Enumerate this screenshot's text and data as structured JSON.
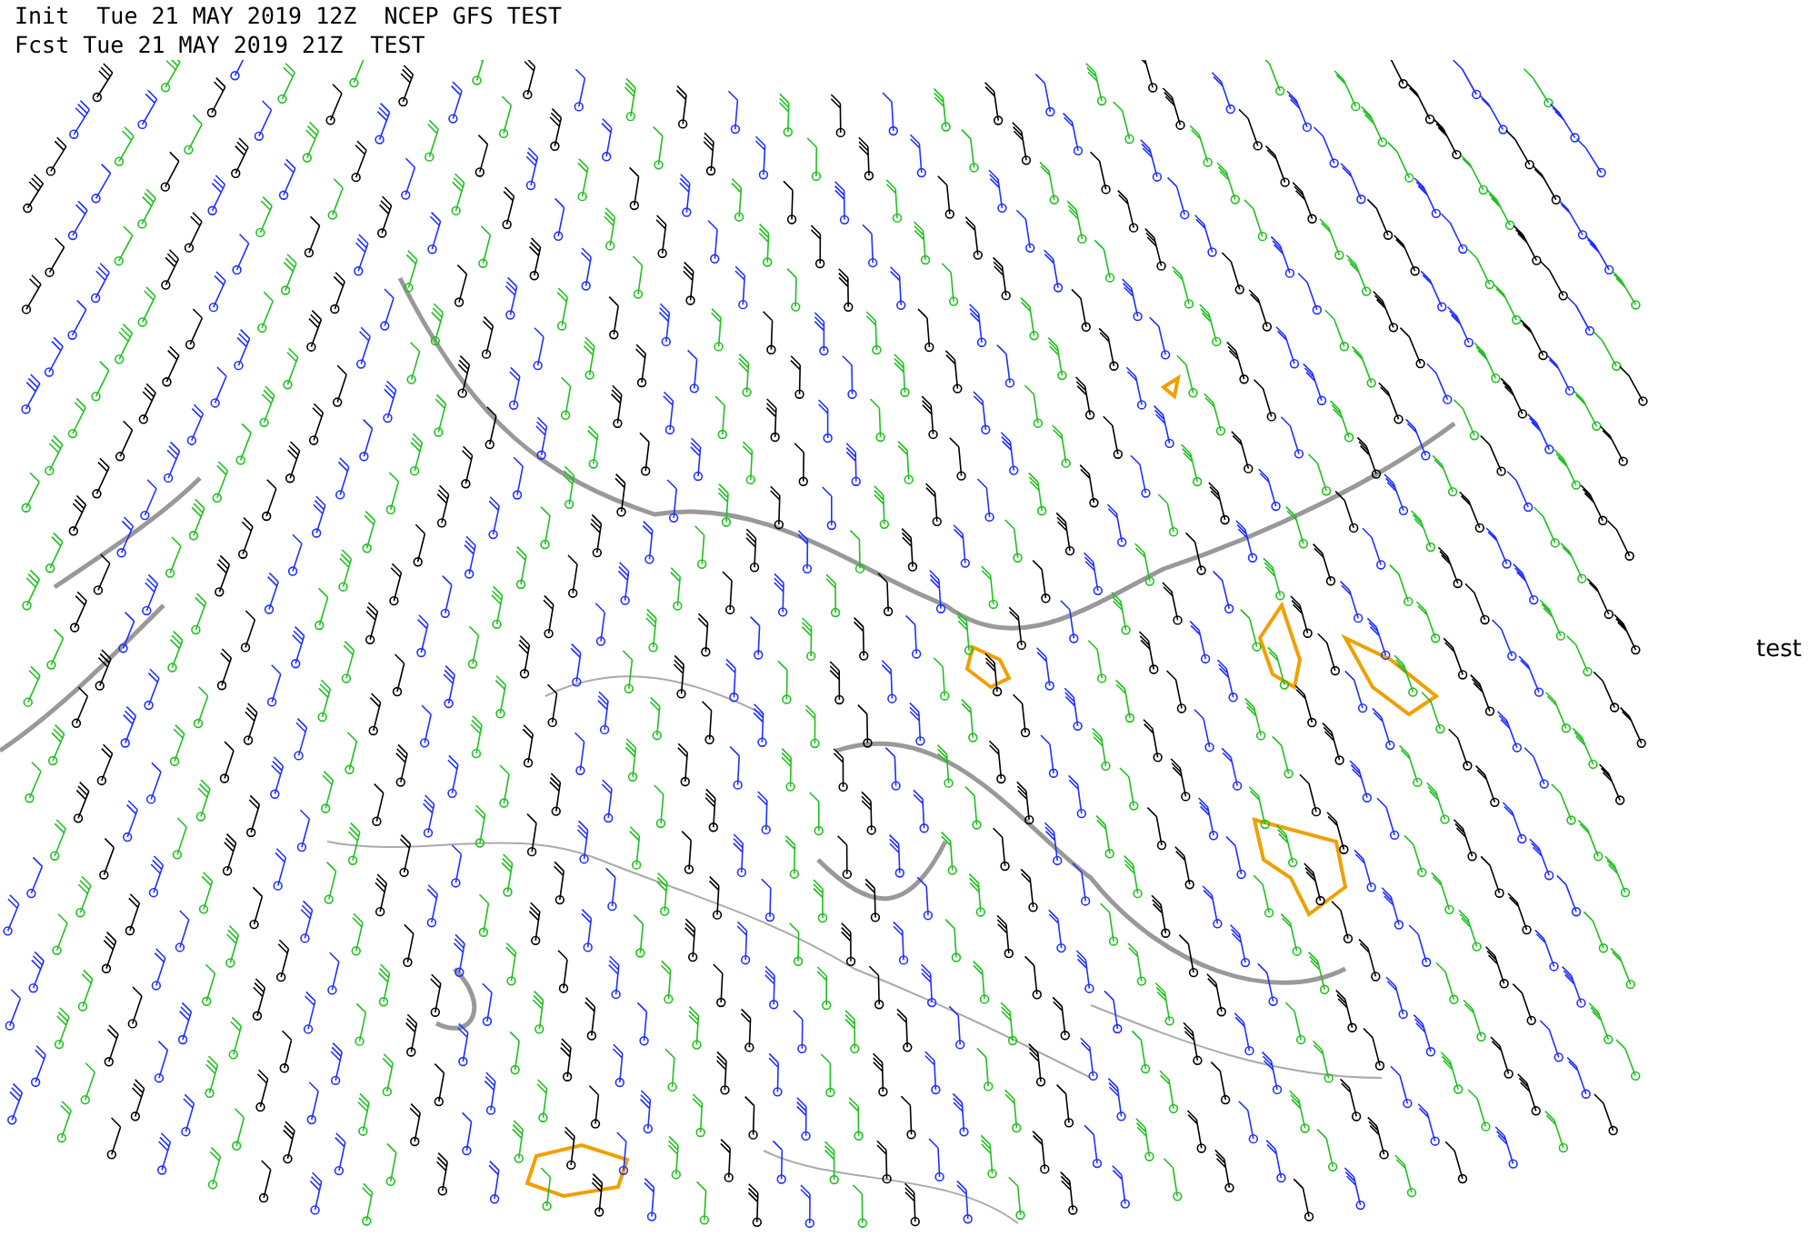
{
  "header": {
    "init_line": "Init  Tue 21 MAY 2019 12Z  NCEP GFS TEST",
    "forecast_line": "Fcst Tue 21 MAY 2019 21Z  TEST"
  },
  "map": {
    "side_label": "test"
  }
}
